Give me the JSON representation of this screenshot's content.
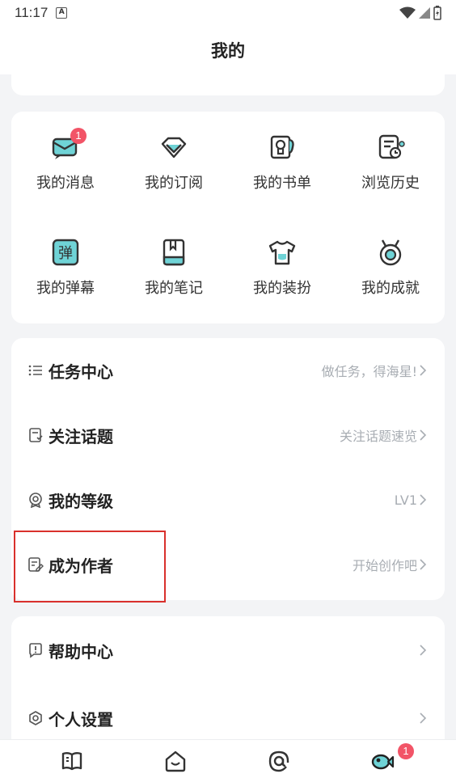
{
  "status_bar": {
    "time": "11:17",
    "notif_letter": "A"
  },
  "header": {
    "title": "我的"
  },
  "grid": {
    "items": [
      {
        "label": "我的消息",
        "icon": "message-icon",
        "badge": "1"
      },
      {
        "label": "我的订阅",
        "icon": "diamond-icon"
      },
      {
        "label": "我的书单",
        "icon": "booklist-icon"
      },
      {
        "label": "浏览历史",
        "icon": "history-icon"
      },
      {
        "label": "我的弹幕",
        "icon": "danmaku-icon",
        "glyph": "弹"
      },
      {
        "label": "我的笔记",
        "icon": "notebook-icon"
      },
      {
        "label": "我的装扮",
        "icon": "tshirt-icon"
      },
      {
        "label": "我的成就",
        "icon": "medal-icon"
      }
    ]
  },
  "list1": [
    {
      "label": "任务中心",
      "hint": "做任务，得海星!",
      "icon": "task-list-icon"
    },
    {
      "label": "关注话题",
      "hint": "关注话题速览",
      "icon": "topic-icon"
    },
    {
      "label": "我的等级",
      "hint": "LV1",
      "icon": "level-icon"
    },
    {
      "label": "成为作者",
      "hint": "开始创作吧",
      "icon": "author-icon"
    }
  ],
  "list2": [
    {
      "label": "帮助中心",
      "hint": "",
      "icon": "help-icon"
    },
    {
      "label": "个人设置",
      "hint": "",
      "icon": "settings-icon"
    }
  ],
  "tabbar": {
    "tabs": [
      {
        "name": "bookshelf",
        "icon": "book-icon"
      },
      {
        "name": "discover",
        "icon": "smile-house-icon"
      },
      {
        "name": "community",
        "icon": "at-icon"
      },
      {
        "name": "mine",
        "icon": "fish-icon",
        "badge": "1"
      }
    ]
  },
  "colors": {
    "accent": "#6fd3d6",
    "badge": "#f25467",
    "highlight": "#d9302c",
    "hint": "#a8adb3"
  }
}
